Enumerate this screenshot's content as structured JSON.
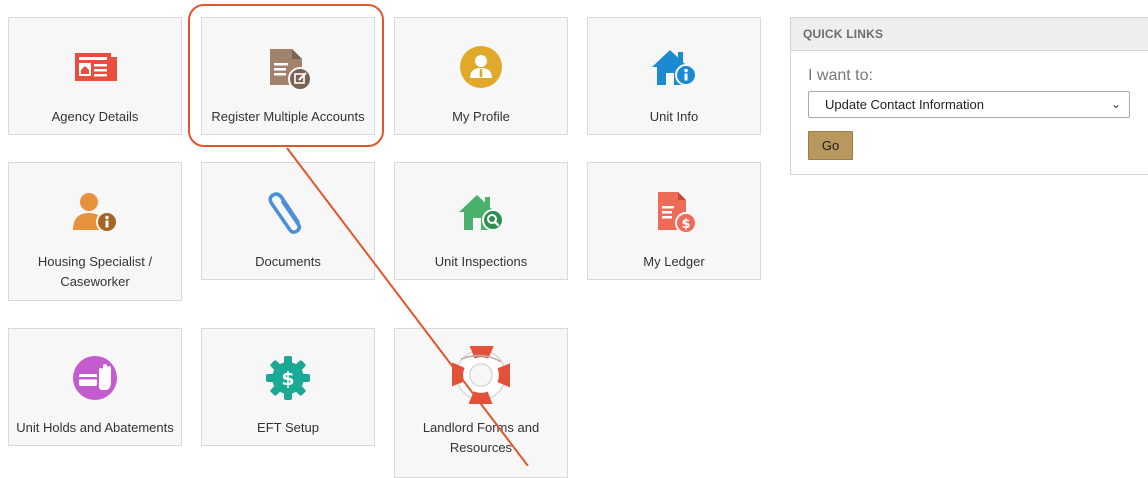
{
  "tiles": [
    {
      "label": "Agency Details",
      "icon": "agency-details-icon"
    },
    {
      "label": "Register Multiple Accounts",
      "icon": "register-accounts-icon"
    },
    {
      "label": "My Profile",
      "icon": "user-profile-icon"
    },
    {
      "label": "Unit Info",
      "icon": "house-info-icon"
    },
    {
      "label": "Housing Specialist / Caseworker",
      "icon": "person-info-icon"
    },
    {
      "label": "Documents",
      "icon": "paperclip-icon"
    },
    {
      "label": "Unit Inspections",
      "icon": "house-search-icon"
    },
    {
      "label": "My Ledger",
      "icon": "ledger-dollar-icon"
    },
    {
      "label": "Unit Holds and Abatements",
      "icon": "card-hand-icon"
    },
    {
      "label": "EFT Setup",
      "icon": "gear-dollar-icon"
    },
    {
      "label": "Landlord Forms and Resources",
      "icon": "lifebuoy-icon"
    }
  ],
  "quick_links": {
    "title": "QUICK LINKS",
    "prompt": "I want to:",
    "selected_option": "Update Contact Information",
    "go_label": "Go"
  },
  "colors": {
    "accent_red": "#e94d3d",
    "brown": "#a0826d",
    "gold": "#e0a92a",
    "blue": "#1b8ad1",
    "orange": "#e7923a",
    "green": "#4ab16c",
    "coral": "#ee6b57",
    "purple": "#c45ccf",
    "teal": "#1aa995",
    "go_button": "#b8985c",
    "annotation": "#e0572f"
  }
}
